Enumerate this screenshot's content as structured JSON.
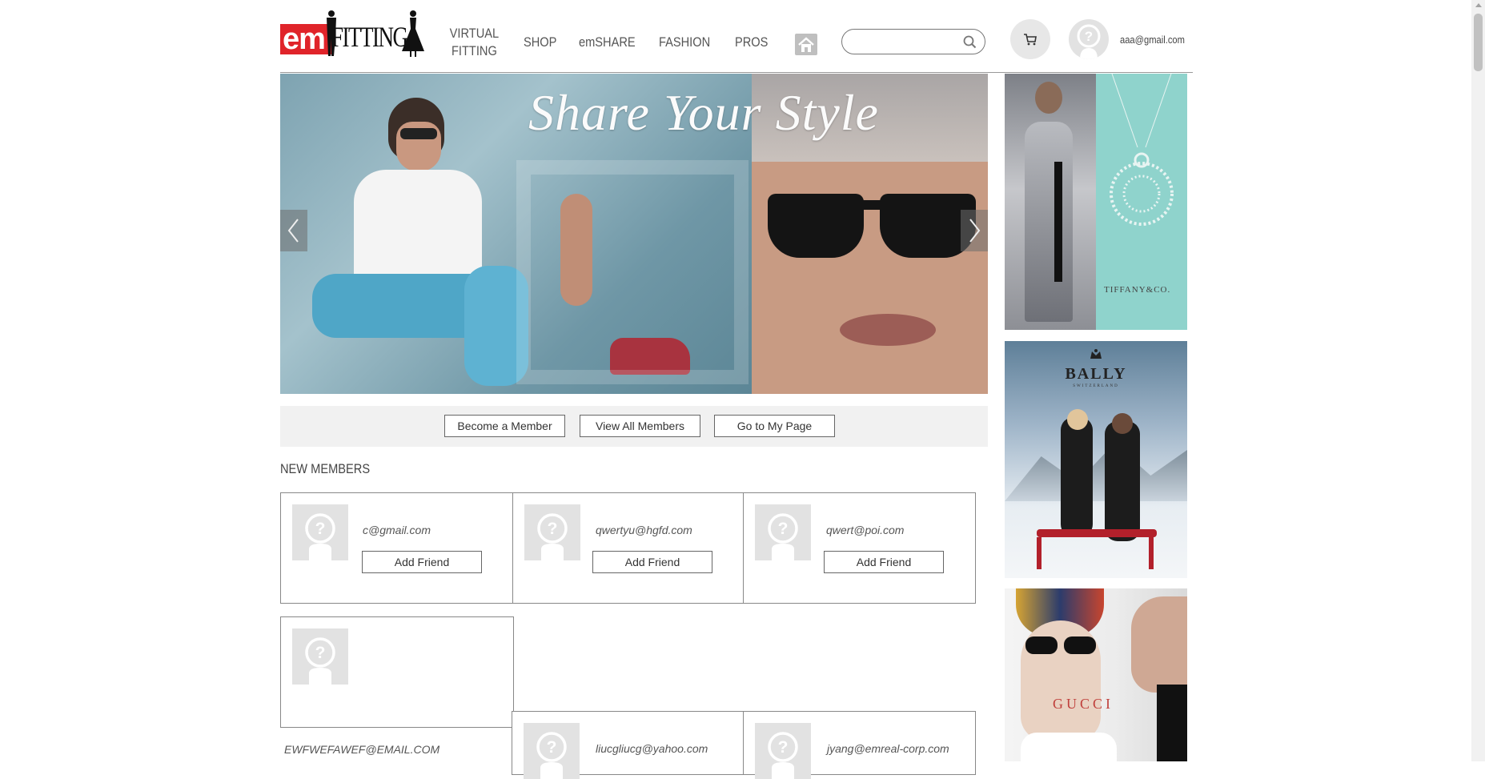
{
  "header": {
    "logo": {
      "em": "em",
      "fitting": "FITTING"
    },
    "nav": [
      {
        "line1": "VIRTUAL",
        "line2": "FITTING"
      },
      {
        "label": "SHOP"
      },
      {
        "label": "emSHARE"
      },
      {
        "label": "FASHION"
      },
      {
        "label": "PROS"
      }
    ],
    "search": {
      "placeholder": "",
      "value": ""
    },
    "user_email": "aaa@gmail.com"
  },
  "banner": {
    "title": "Share Your Style"
  },
  "actions": {
    "become_member": "Become a Member",
    "view_all": "View All Members",
    "my_page": "Go to My Page"
  },
  "section": {
    "title": "NEW MEMBERS"
  },
  "members": [
    {
      "email": "c@gmail.com",
      "button": "Add Friend"
    },
    {
      "email": "qwertyu@hgfd.com",
      "button": "Add Friend"
    },
    {
      "email": "qwert@poi.com",
      "button": "Add Friend"
    },
    {
      "email": "EWFWEFAWEF@EMAIL.COM"
    },
    {
      "email": "liucgliucg@yahoo.com"
    },
    {
      "email": "jyang@emreal-corp.com"
    }
  ],
  "ads": {
    "tiffany": "TIFFANY&CO.",
    "bally": "BALLY",
    "bally_sub": "SWITZERLAND",
    "gucci": "GUCCI"
  },
  "colors": {
    "brand_red": "#e0242a",
    "tiffany_blue": "#8fd3cc"
  }
}
